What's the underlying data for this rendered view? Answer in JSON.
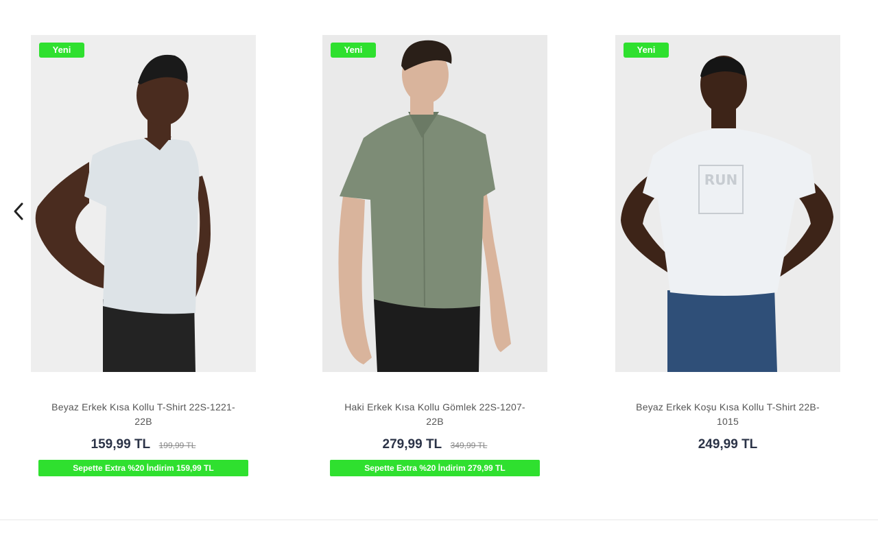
{
  "navigation": {
    "prev_icon": "chevron-left-icon"
  },
  "products": [
    {
      "badge": "Yeni",
      "name_line1": "Beyaz Erkek Kısa Kollu T-Shirt 22S-1221-",
      "name_line2": "22B",
      "price": "159,99 TL",
      "old_price": "199,99 TL",
      "promo": "Sepette Extra %20 İndirim 159,99 TL",
      "image": "model-white-vneck-tshirt"
    },
    {
      "badge": "Yeni",
      "name_line1": "Haki Erkek Kısa Kollu Gömlek 22S-1207-",
      "name_line2": "22B",
      "price": "279,99 TL",
      "old_price": "349,99 TL",
      "promo": "Sepette Extra %20 İndirim 279,99 TL",
      "image": "model-khaki-shirt"
    },
    {
      "badge": "Yeni",
      "name_line1": "Beyaz Erkek Koşu Kısa Kollu T-Shirt 22B-",
      "name_line2": "1015",
      "price": "249,99 TL",
      "old_price": "",
      "promo": "",
      "image": "model-white-run-tshirt"
    }
  ],
  "colors": {
    "badge_green": "#2fe02f",
    "price_text": "#2b3347"
  }
}
